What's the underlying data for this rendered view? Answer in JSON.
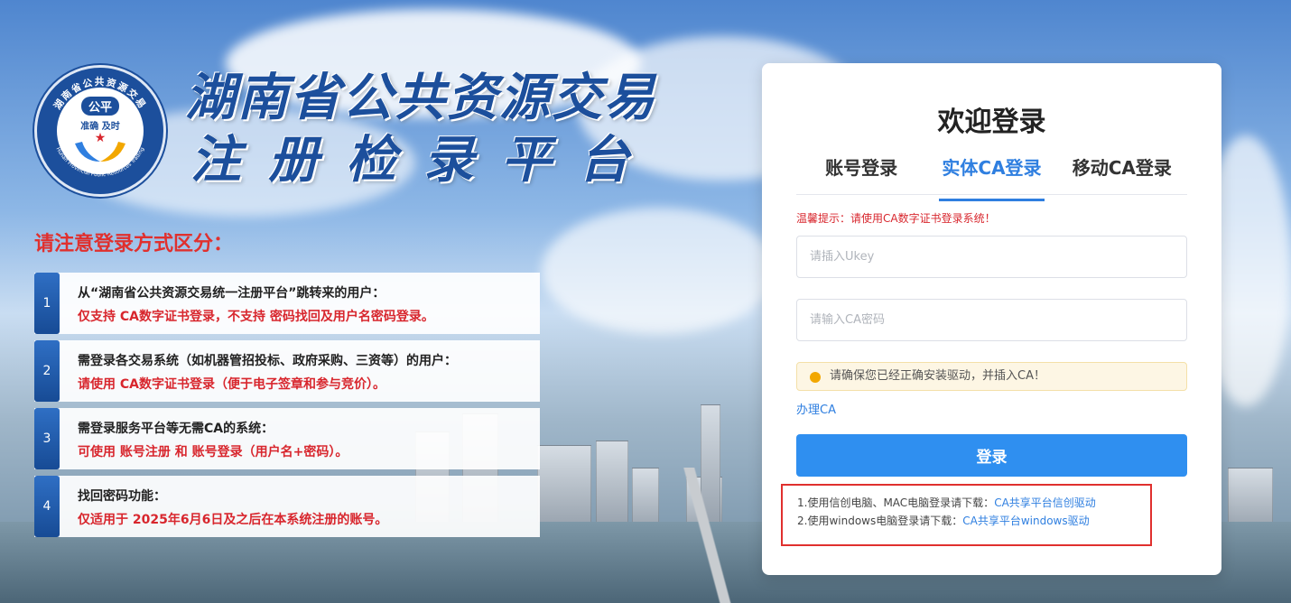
{
  "logo": {
    "ring_text": "湖南省公共资源交易",
    "ring_text_en": "Hunan Provincial Public Resources Trading",
    "badge": "公平",
    "motto": "准确 及时"
  },
  "title": {
    "line1": "湖南省公共资源交易",
    "line2": "注册检录平台"
  },
  "notes": {
    "heading": "请注意登录方式区分：",
    "items": [
      {
        "num": "1",
        "title": "从“湖南省公共资源交易统一注册平台”跳转来的用户：",
        "desc": "仅支持 CA数字证书登录，不支持 密码找回及用户名密码登录。"
      },
      {
        "num": "2",
        "title": "需登录各交易系统（如机器管招投标、政府采购、三资等）的用户：",
        "desc": "请使用 CA数字证书登录（便于电子签章和参与竞价）。"
      },
      {
        "num": "3",
        "title": "需登录服务平台等无需CA的系统：",
        "desc": "可使用 账号注册 和 账号登录（用户名+密码）。"
      },
      {
        "num": "4",
        "title": "找回密码功能：",
        "desc": "仅适用于 2025年6月6日及之后在本系统注册的账号。"
      }
    ]
  },
  "login": {
    "title": "欢迎登录",
    "tabs": [
      "账号登录",
      "实体CA登录",
      "移动CA登录"
    ],
    "active_tab": "实体CA登录",
    "hint": "温馨提示：请使用CA数字证书登录系统！",
    "ukey_placeholder": "请插入Ukey",
    "password_placeholder": "请输入CA密码",
    "warning": "请确保您已经正确安装驱动，并插入CA！",
    "apply_ca": "办理CA",
    "submit": "登录",
    "downloads": [
      {
        "prefix": "1.使用信创电脑、MAC电脑登录请下载：",
        "link": "CA共享平台信创驱动"
      },
      {
        "prefix": "2.使用windows电脑登录请下载：",
        "link": "CA共享平台windows驱动"
      }
    ]
  },
  "colors": {
    "brand_blue": "#1c4f9c",
    "accent_blue": "#2f7fe0",
    "button_blue": "#2f8ff0",
    "alert_red": "#d8262d",
    "warning_bg": "#fdf6e4"
  }
}
